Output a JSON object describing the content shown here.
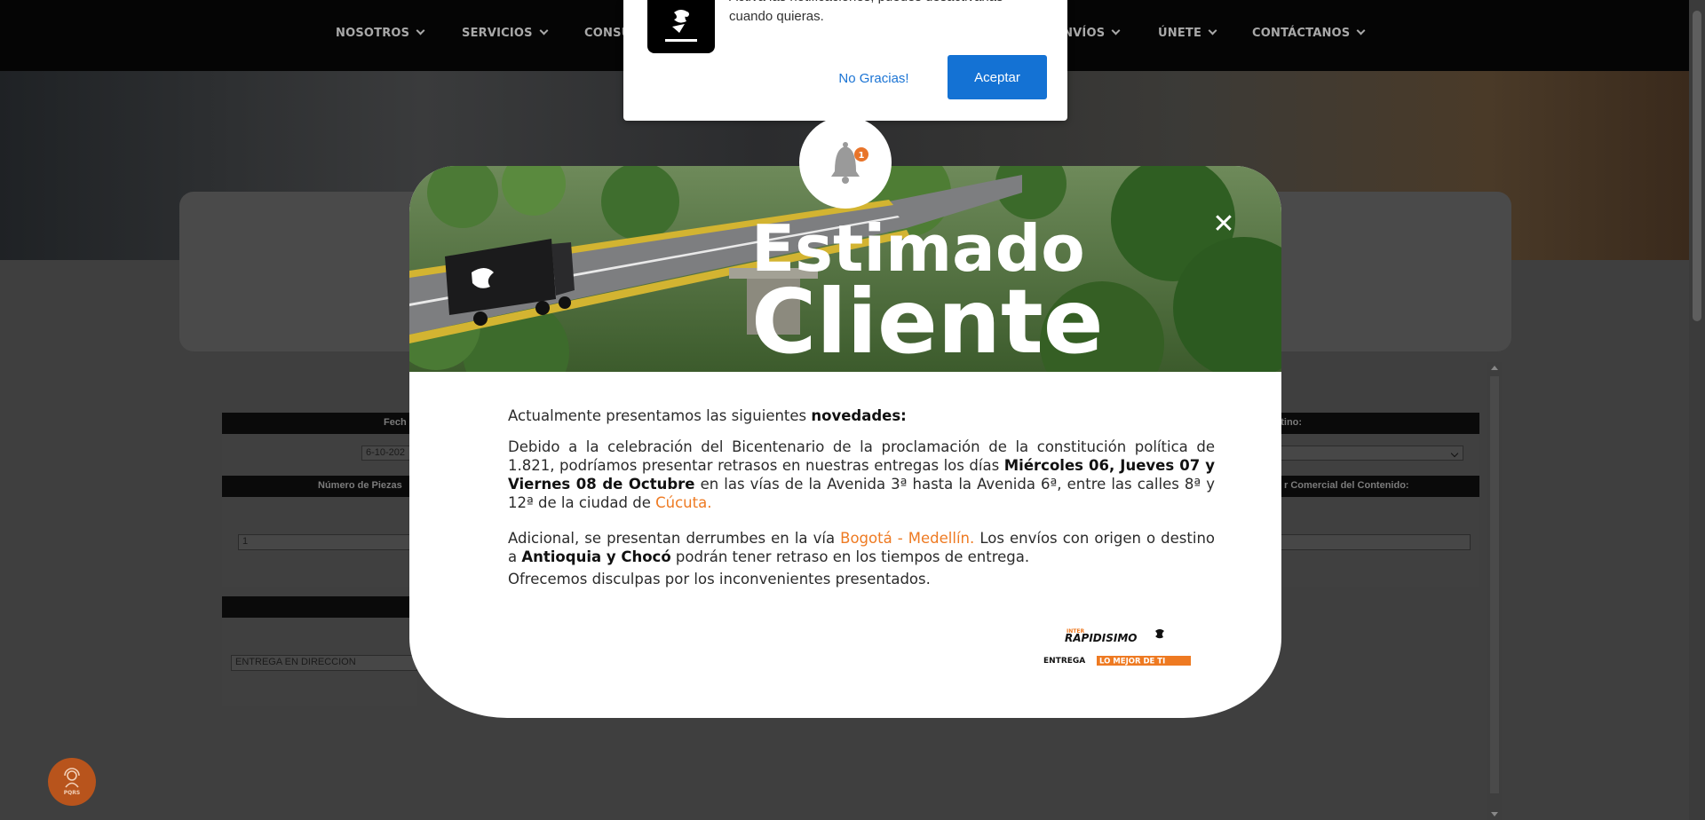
{
  "nav": {
    "items": [
      "NOSOTROS",
      "SERVICIOS",
      "CONSU",
      "ENVÍOS",
      "ÚNETE",
      "CONTÁCTANOS"
    ]
  },
  "form": {
    "bar1_left": "Fech",
    "bar1_right": "estino:",
    "date_value": "6-10-202",
    "bar2_left": "Número de Piezas",
    "bar2_right": "r Comercial del Contenido:",
    "pieces_value": "1",
    "delivery_value": "ENTREGA EN DIRECCION"
  },
  "pqrs": {
    "label": "PQRS"
  },
  "notification": {
    "message": "Activa las notificaciones, puedes desactivarlas cuando quieras.",
    "decline_label": "No Gracias!",
    "accept_label": "Aceptar",
    "bell_badge": "1"
  },
  "modal": {
    "banner_title_line1": "Estimado",
    "banner_title_line2": "Cliente",
    "close_symbol": "✕",
    "intro_text": "Actualmente presentamos las siguientes",
    "intro_bold": "novedades:",
    "p1_a": "Debido a la celebración del Bicentenario de la proclamación de la constitución política de 1.821, podríamos presentar retrasos en nuestras entregas los días",
    "p1_bold": "Miércoles 06, Jueves 07 y  Viernes 08 de Octubre",
    "p1_b": "en las vías de la Avenida 3ª hasta la Avenida 6ª, entre las calles 8ª y 12ª  de la ciudad de",
    "p1_city": "Cúcuta.",
    "p2_a": "Adicional, se presentan derrumbes en la vía",
    "p2_route": "Bogotá - Medellín.",
    "p2_b": "Los envíos con origen o destino a",
    "p2_bold": "Antioquia y Chocó",
    "p2_c": "podrán tener retraso en los tiempos de entrega.",
    "p3": "Ofrecemos disculpas por los inconvenientes presentados.",
    "brand_name": "RAPIDISIMO",
    "brand_small": "INTER",
    "slogan_a": "ENTREGA",
    "slogan_b": "LO MEJOR DE TI"
  }
}
